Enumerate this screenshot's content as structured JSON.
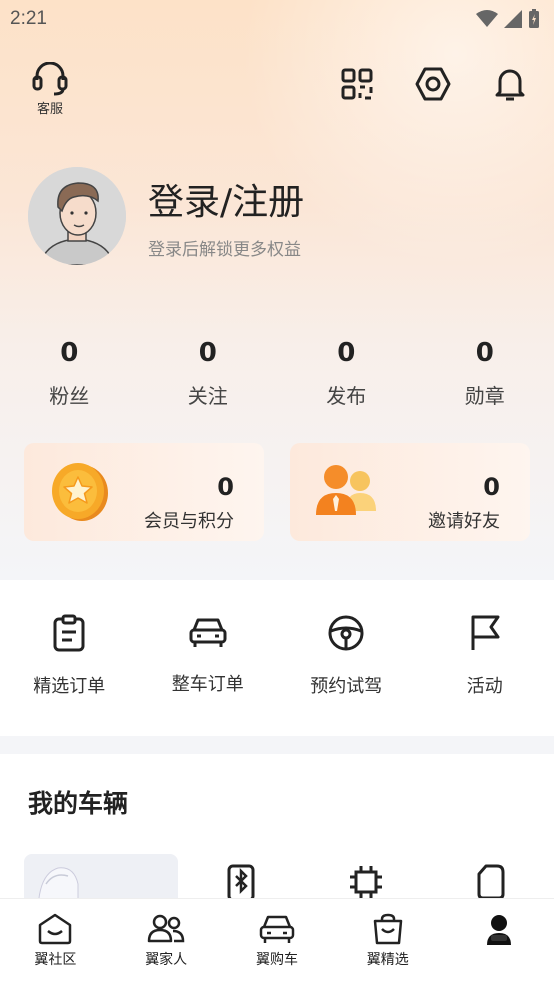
{
  "status_bar": {
    "time": "2:21"
  },
  "header": {
    "customer_service_label": "客服"
  },
  "profile": {
    "title": "登录/注册",
    "subtitle": "登录后解锁更多权益"
  },
  "stats": [
    {
      "value": "0",
      "label": "粉丝"
    },
    {
      "value": "0",
      "label": "关注"
    },
    {
      "value": "0",
      "label": "发布"
    },
    {
      "value": "0",
      "label": "勋章"
    }
  ],
  "cards": [
    {
      "value": "0",
      "label": "会员与积分",
      "icon": "star-coin-icon"
    },
    {
      "value": "0",
      "label": "邀请好友",
      "icon": "people-icon"
    }
  ],
  "orders": [
    {
      "label": "精选订单",
      "icon": "clipboard-icon"
    },
    {
      "label": "整车订单",
      "icon": "car-icon"
    },
    {
      "label": "预约试驾",
      "icon": "steering-wheel-icon"
    },
    {
      "label": "活动",
      "icon": "flag-icon"
    }
  ],
  "vehicle": {
    "title": "我的车辆"
  },
  "tabs": [
    {
      "label": "翼社区",
      "icon": "community-icon"
    },
    {
      "label": "翼家人",
      "icon": "family-icon"
    },
    {
      "label": "翼购车",
      "icon": "car-icon"
    },
    {
      "label": "翼精选",
      "icon": "shopping-bag-icon"
    },
    {
      "label": "",
      "icon": "profile-icon"
    }
  ],
  "colors": {
    "accent": "#f5a623",
    "hero_top": "#fde2c8"
  }
}
